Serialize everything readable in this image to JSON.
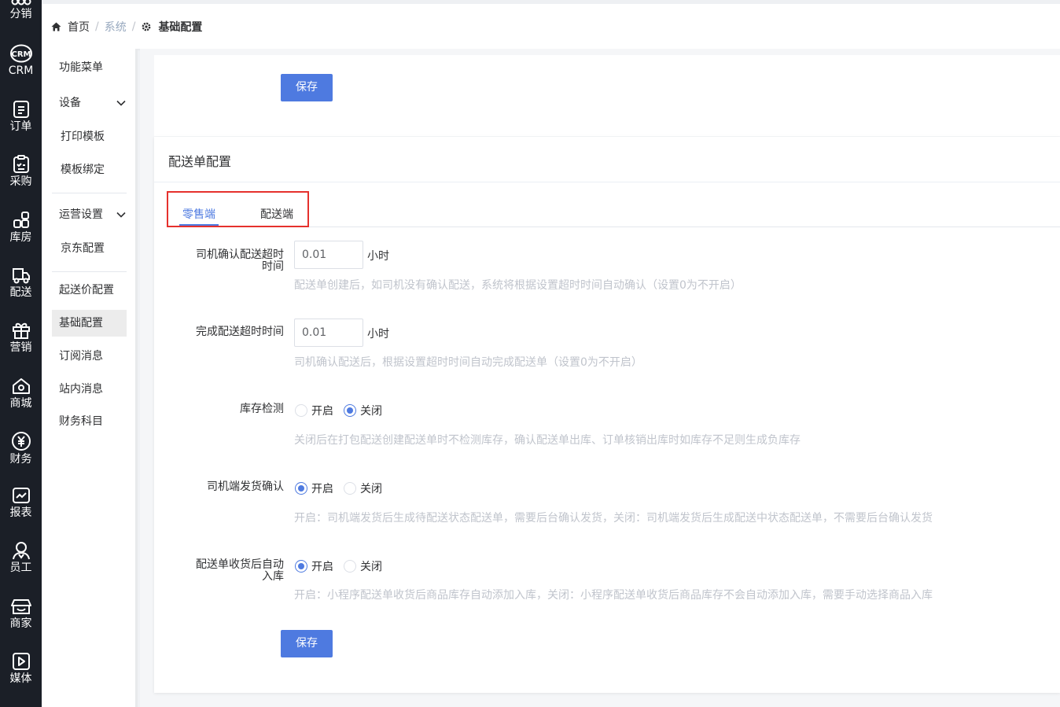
{
  "iconbar": [
    {
      "label": "分销",
      "icon": "distribution-icon"
    },
    {
      "label": "CRM",
      "icon": "crm-icon"
    },
    {
      "label": "订单",
      "icon": "order-icon"
    },
    {
      "label": "采购",
      "icon": "purchase-icon"
    },
    {
      "label": "库房",
      "icon": "warehouse-icon"
    },
    {
      "label": "配送",
      "icon": "delivery-icon"
    },
    {
      "label": "营销",
      "icon": "marketing-icon"
    },
    {
      "label": "商城",
      "icon": "mall-icon"
    },
    {
      "label": "财务",
      "icon": "finance-icon"
    },
    {
      "label": "报表",
      "icon": "report-icon"
    },
    {
      "label": "员工",
      "icon": "staff-icon"
    },
    {
      "label": "商家",
      "icon": "merchant-icon"
    },
    {
      "label": "媒体",
      "icon": "media-icon"
    }
  ],
  "breadcrumb": {
    "home": "首页",
    "section": "系统",
    "current": "基础配置",
    "separator": "/"
  },
  "submenu": {
    "items": [
      {
        "label": "功能菜单"
      },
      {
        "label": "设备"
      },
      {
        "label": "打印模板"
      },
      {
        "label": "模板绑定"
      },
      {
        "label": "运营设置"
      },
      {
        "label": "京东配置"
      },
      {
        "label": "起送价配置"
      },
      {
        "label": "基础配置"
      },
      {
        "label": "订阅消息"
      },
      {
        "label": "站内消息"
      },
      {
        "label": "财务科目"
      }
    ]
  },
  "main": {
    "save_label": "保存",
    "section_title": "配送单配置",
    "tabs": [
      {
        "label": "零售端"
      },
      {
        "label": "配送端"
      }
    ],
    "fields": {
      "driver_confirm": {
        "label": "司机确认配送超时时间",
        "label_line1": "司机确认配送超时",
        "label_line2": "时间",
        "value": "0.01",
        "unit": "小时",
        "hint": "配送单创建后，如司机没有确认配送，系统将根据设置超时时间自动确认（设置0为不开启）"
      },
      "complete_timeout": {
        "label": "完成配送超时时间",
        "value": "0.01",
        "unit": "小时",
        "hint": "司机确认配送后，根据设置超时时间自动完成配送单（设置0为不开启）"
      },
      "stock_check": {
        "label": "库存检测",
        "options": [
          "开启",
          "关闭"
        ],
        "selected": "关闭",
        "hint": "关闭后在打包配送创建配送单时不检测库存，确认配送单出库、订单核销出库时如库存不足则生成负库存"
      },
      "driver_ship_confirm": {
        "label": "司机端发货确认",
        "options": [
          "开启",
          "关闭"
        ],
        "selected": "开启",
        "hint": "开启：司机端发货后生成待配送状态配送单，需要后台确认发货，关闭：司机端发货后生成配送中状态配送单，不需要后台确认发货"
      },
      "auto_stock_in": {
        "label": "配送单收货后自动入库",
        "label_line1": "配送单收货后自动",
        "label_line2": "入库",
        "options": [
          "开启",
          "关闭"
        ],
        "selected": "开启",
        "hint": "开启：小程序配送单收货后商品库存自动添加入库，关闭：小程序配送单收货后商品库存不会自动添加入库，需要手动选择商品入库"
      }
    }
  },
  "colors": {
    "primary": "#4e7ae0",
    "sidebar_bg": "#1b1f27",
    "highlight_border": "#e5312d"
  }
}
